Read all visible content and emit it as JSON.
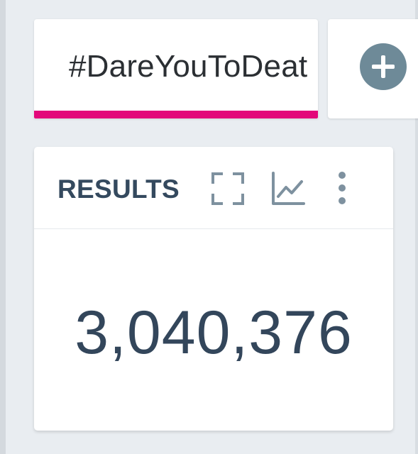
{
  "tabs": [
    {
      "label": "#DareYouToDeat",
      "active": true,
      "accent_color": "#e3087a"
    }
  ],
  "add_panel": {
    "icon": "plus-circle-icon"
  },
  "results_card": {
    "title": "RESULTS",
    "icons": [
      "expand-icon",
      "trend-chart-icon",
      "more-vert-icon"
    ],
    "value": "3,040,376"
  },
  "colors": {
    "background": "#e9edf1",
    "title_text": "#34495e",
    "value_text": "#33465b",
    "icon_gray": "#7e919f",
    "add_button": "#6e8a98"
  }
}
